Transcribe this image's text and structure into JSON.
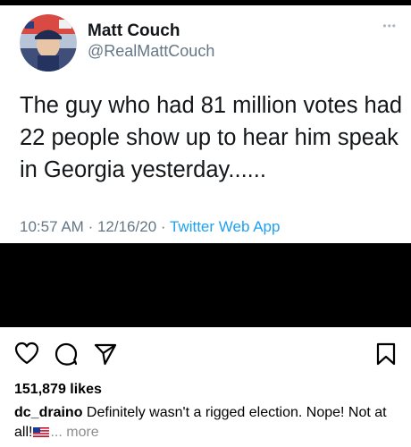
{
  "tweet": {
    "display_name": "Matt Couch",
    "handle": "@RealMattCouch",
    "more_icon": "more-dots-icon",
    "text": "The guy who had 81 million votes had 22 people show up to hear him speak in Georgia yesterday......",
    "time": "10:57 AM",
    "separator": "·",
    "date": "12/16/20",
    "app": "Twitter Web App"
  },
  "post": {
    "icons": [
      "heart-icon",
      "comment-icon",
      "share-icon",
      "bookmark-icon"
    ],
    "likes": "151,879 likes",
    "username": "dc_draino",
    "caption_text": "Definitely wasn't a rigged election. Nope! Not at all!",
    "flag_icon": "us-flag-icon",
    "more_label": "... more"
  },
  "colors": {
    "text": "#14171a",
    "secondary": "#657786",
    "link": "#1da1f2",
    "muted": "#8e8e8e",
    "band": "#000000"
  }
}
